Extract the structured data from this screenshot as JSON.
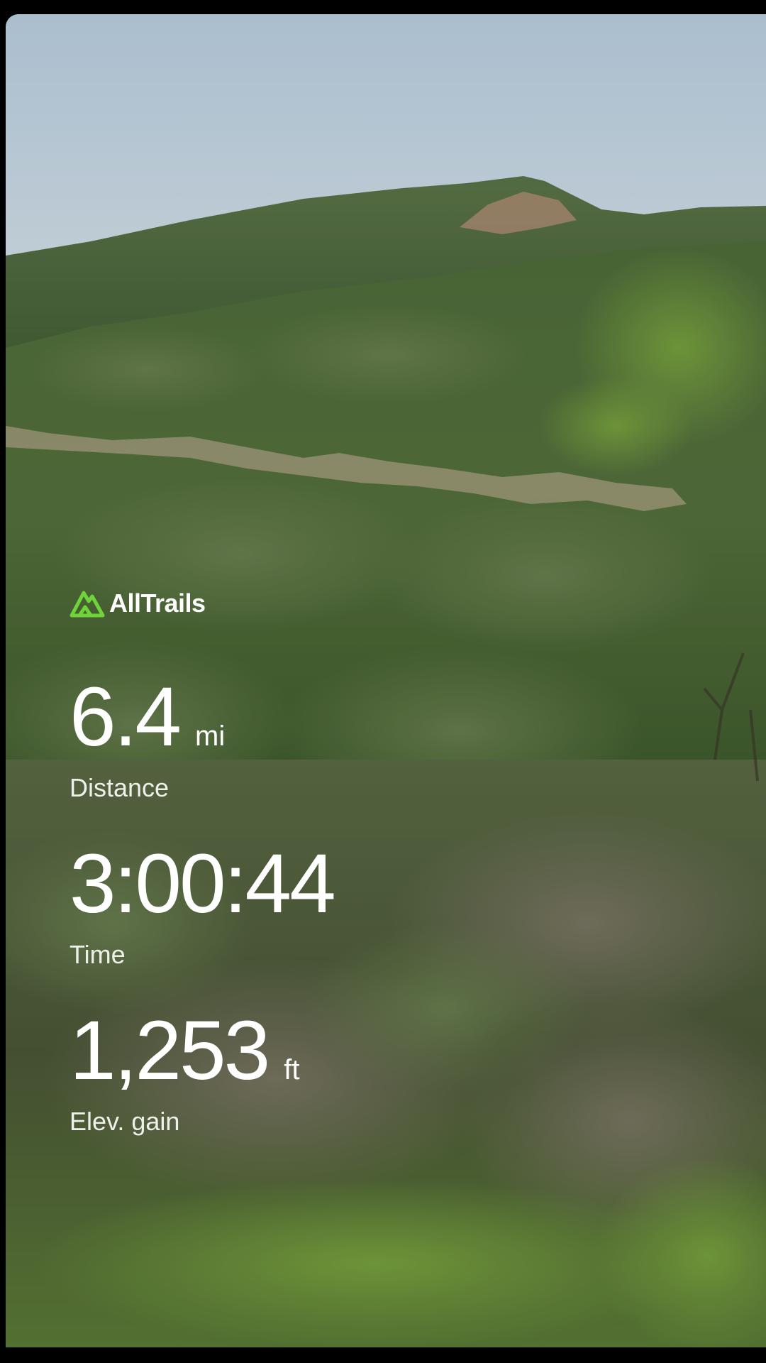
{
  "brand": {
    "name": "AllTrails",
    "icon": "alltrails-mountain-logo",
    "accent_color": "#6fd33a"
  },
  "stats": {
    "distance": {
      "value": "6.4",
      "unit": "mi",
      "label": "Distance"
    },
    "time": {
      "value": "3:00:44",
      "label": "Time"
    },
    "elevation": {
      "value": "1,253",
      "unit": "ft",
      "label": "Elev. gain"
    }
  }
}
